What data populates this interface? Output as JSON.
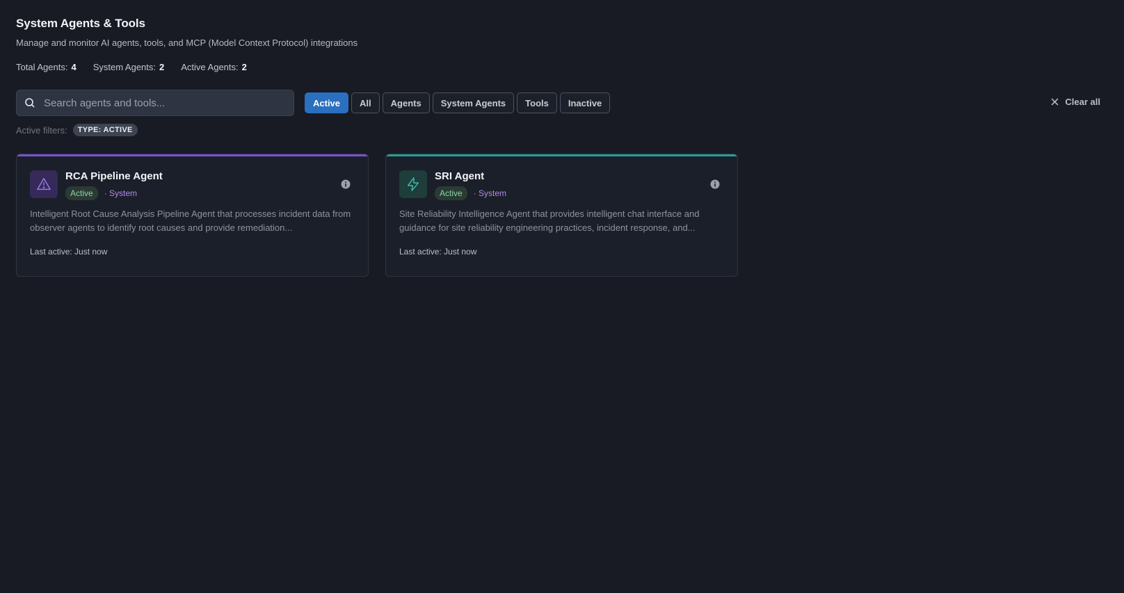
{
  "header": {
    "title": "System Agents & Tools",
    "subtitle": "Manage and monitor AI agents, tools, and MCP (Model Context Protocol) integrations"
  },
  "stats": [
    {
      "label": "Total Agents:",
      "value": "4"
    },
    {
      "label": "System Agents:",
      "value": "2"
    },
    {
      "label": "Active Agents:",
      "value": "2"
    }
  ],
  "search": {
    "placeholder": "Search agents and tools..."
  },
  "filters": [
    {
      "label": "Active",
      "selected": true
    },
    {
      "label": "All",
      "selected": false
    },
    {
      "label": "Agents",
      "selected": false
    },
    {
      "label": "System Agents",
      "selected": false
    },
    {
      "label": "Tools",
      "selected": false
    },
    {
      "label": "Inactive",
      "selected": false
    }
  ],
  "clear_all_label": "Clear all",
  "active_filters": {
    "label": "Active filters:",
    "tags": [
      "TYPE: ACTIVE"
    ]
  },
  "agents": [
    {
      "name": "RCA Pipeline Agent",
      "status": "Active",
      "category": "· System",
      "icon": "warning-triangle-icon",
      "accent": "#7b4fd6",
      "description": "Intelligent Root Cause Analysis Pipeline Agent that processes incident data from observer agents to identify root causes and provide remediation...",
      "last_active": "Last active: Just now"
    },
    {
      "name": "SRI Agent",
      "status": "Active",
      "category": "· System",
      "icon": "lightning-bolt-icon",
      "accent": "#2a9e96",
      "description": "Site Reliability Intelligence Agent that provides intelligent chat interface and guidance for site reliability engineering practices, incident response, and...",
      "last_active": "Last active: Just now"
    }
  ],
  "colors": {
    "primary": "#2b6fc0",
    "background": "#181b23",
    "status_active": "#8fd3a6",
    "system": "#b28bea"
  }
}
